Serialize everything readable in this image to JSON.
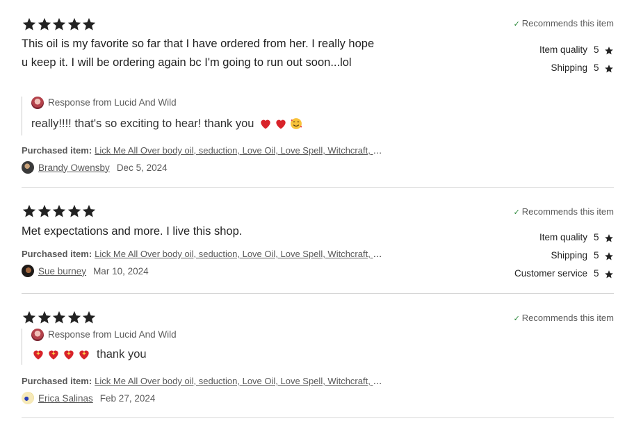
{
  "reviews": [
    {
      "stars": 5,
      "recommends": "Recommends this item",
      "ratings": [
        {
          "label": "Item quality",
          "value": "5"
        },
        {
          "label": "Shipping",
          "value": "5"
        }
      ],
      "text": "This oil is my favorite so far that I have ordered from her. I really hope u keep it. I will be ordering again bc I'm going to run out soon...lol",
      "response": {
        "from": "Response from Lucid And Wild",
        "text": "really!!!! that's so exciting to hear! thank you"
      },
      "purchased_label": "Purchased item:",
      "purchased_item": "Lick Me All Over body oil, seduction, Love Oil, Love Spell, Witchcraft, Spell Oil",
      "reviewer": "Brandy Owensby",
      "date": "Dec 5, 2024"
    },
    {
      "stars": 5,
      "recommends": "Recommends this item",
      "ratings": [
        {
          "label": "Item quality",
          "value": "5"
        },
        {
          "label": "Shipping",
          "value": "5"
        },
        {
          "label": "Customer service",
          "value": "5"
        }
      ],
      "text": "Met expectations and more. I live this shop.",
      "purchased_label": "Purchased item:",
      "purchased_item": "Lick Me All Over body oil, seduction, Love Oil, Love Spell, Witchcraft, Spell Oil",
      "reviewer": "Sue burney",
      "date": "Mar 10, 2024"
    },
    {
      "stars": 5,
      "recommends": "Recommends this item",
      "response": {
        "from": "Response from Lucid And Wild",
        "text": "thank you"
      },
      "purchased_label": "Purchased item:",
      "purchased_item": "Lick Me All Over body oil, seduction, Love Oil, Love Spell, Witchcraft, Spell Oil",
      "reviewer": "Erica Salinas",
      "date": "Feb 27, 2024"
    }
  ],
  "icons": {
    "star": "star-icon",
    "check": "checkmark-icon",
    "heart": "red-heart-emoji",
    "smiling_hearts": "smiling-face-with-hearts-emoji",
    "sparkling_heart": "sparkling-heart-emoji"
  },
  "colors": {
    "text": "#222222",
    "muted": "#595959",
    "check": "#258635",
    "divider": "#d6d6d6",
    "heart": "#d8232a"
  }
}
